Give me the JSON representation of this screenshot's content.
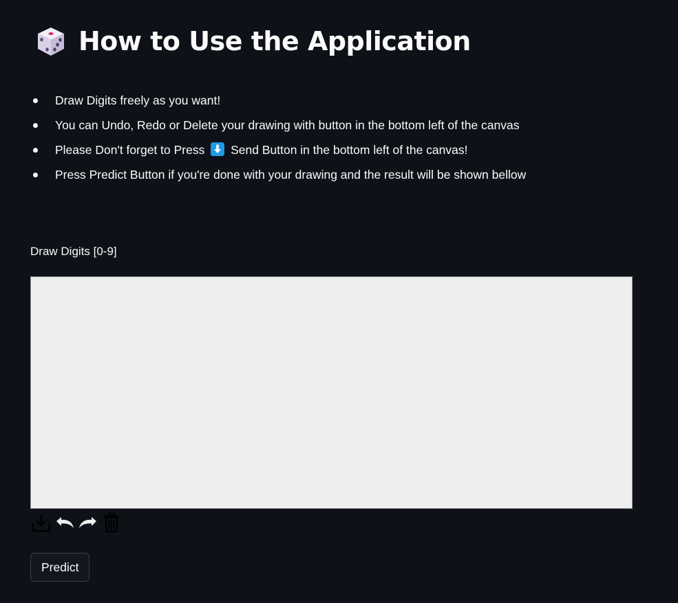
{
  "title": {
    "icon": "die-icon",
    "text": "How to Use the Application"
  },
  "instructions": [
    {
      "text": "Draw Digits freely as you want!"
    },
    {
      "text": "You can Undo, Redo or Delete your drawing with button in the bottom left of the canvas"
    },
    {
      "before": "Please Don't forget to Press",
      "icon": "down-arrow-emoji-icon",
      "after": "Send Button in the bottom left of the canvas!"
    },
    {
      "text": "Press Predict Button if you're done with your drawing and the result will be shown bellow"
    }
  ],
  "canvas": {
    "label": "Draw Digits [0-9]",
    "background_color": "#eeeeee",
    "toolbar": [
      "download-icon",
      "undo-icon",
      "redo-icon",
      "trash-icon"
    ]
  },
  "predict_button": {
    "label": "Predict"
  },
  "colors": {
    "page_background": "#0e1117",
    "text": "#fafafa",
    "emoji_blue": "#1e9be6"
  }
}
